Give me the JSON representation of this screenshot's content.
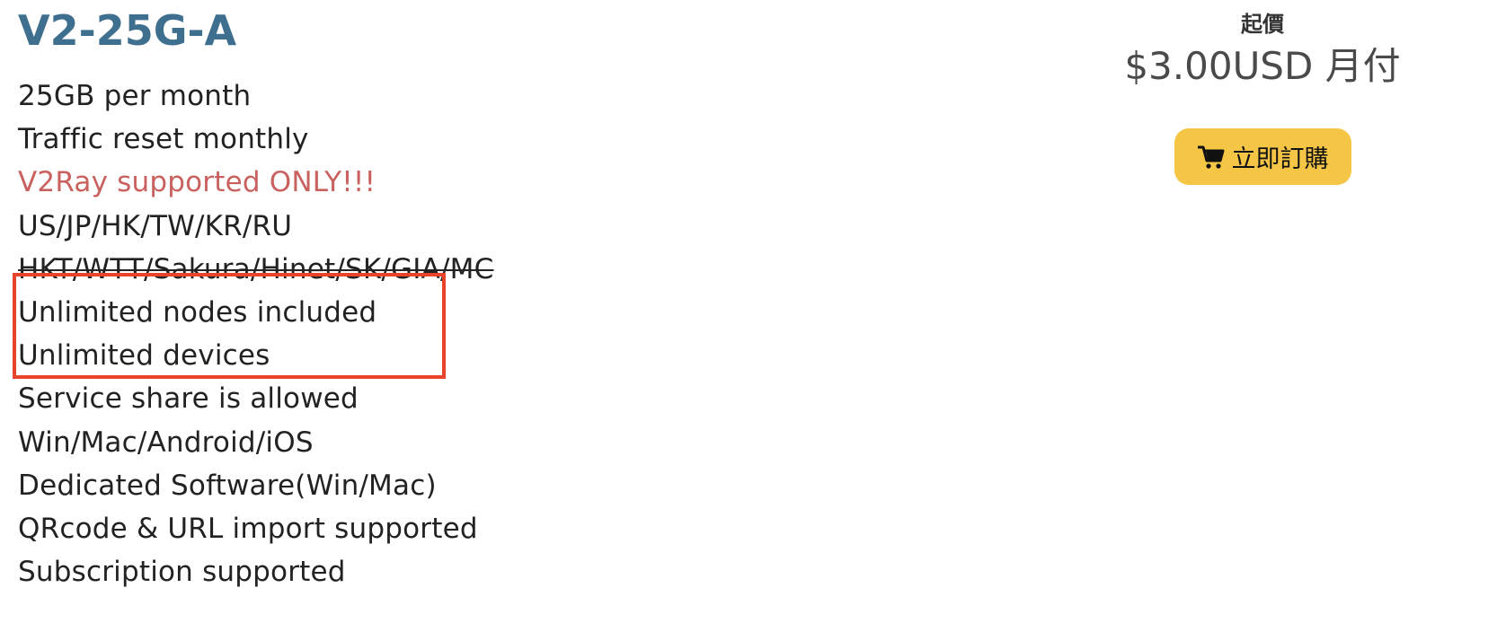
{
  "plan": {
    "title": "V2-25G-A",
    "features": [
      "25GB per month",
      "Traffic reset monthly",
      "V2Ray supported ONLY!!!",
      "US/JP/HK/TW/KR/RU",
      "HKT/WTT/Sakura/Hinet/SK/GIA/MC",
      "Unlimited nodes included",
      "Unlimited devices",
      "Service share is allowed",
      "Win/Mac/Android/iOS",
      "Dedicated Software(Win/Mac)",
      "QRcode & URL import supported",
      "Subscription supported"
    ]
  },
  "pricing": {
    "label": "起價",
    "price": "$3.00USD 月付",
    "order_button_label": "立即訂購",
    "order_button_icon": "cart-icon"
  },
  "colors": {
    "title": "#3f6f8f",
    "highlight_text": "#c9625e",
    "button_bg": "#f5c645",
    "callout_border": "#e8442c"
  }
}
